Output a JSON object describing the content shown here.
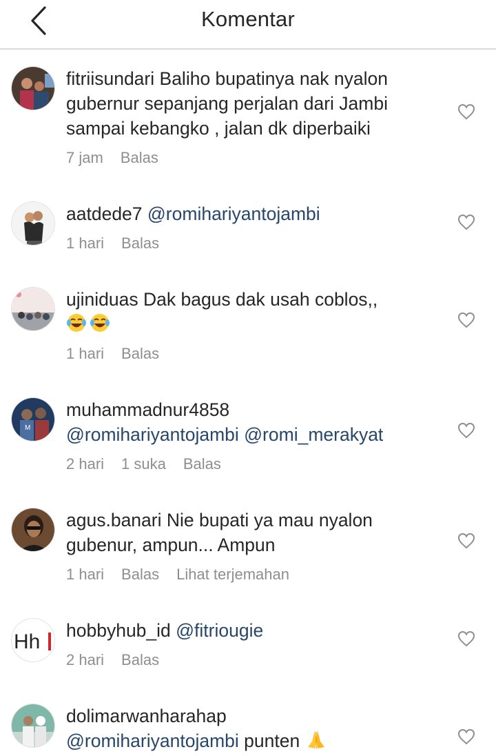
{
  "header": {
    "title": "Komentar",
    "back_icon": "chevron-left-icon"
  },
  "comments": [
    {
      "username": "fitriisundari",
      "text": "Baliho bupatinya nak nyalon gubernur sepanjang perjalan dari Jambi sampai kebangko , jalan dk diperbaiki",
      "time": "7 jam",
      "reply": "Balas"
    },
    {
      "username": "aatdede7",
      "mention": "@romihariyantojambi",
      "time": "1 hari",
      "reply": "Balas"
    },
    {
      "username": "ujiniduas",
      "text": "Dak bagus dak usah coblos,,",
      "emoji": "face-with-tears-of-joy x2",
      "time": "1 hari",
      "reply": "Balas"
    },
    {
      "username": "muhammadnur4858",
      "mention1": "@romihariyantojambi",
      "mention2": "@romi_merakyat",
      "time": "2 hari",
      "likes": "1 suka",
      "reply": "Balas"
    },
    {
      "username": "agus.banari",
      "text": "Nie bupati ya mau nyalon gubenur, ampun... Ampun",
      "time": "1 hari",
      "reply": "Balas",
      "translate": "Lihat terjemahan"
    },
    {
      "username": "hobbyhub_id",
      "mention": "@fitriougie",
      "time": "2 hari",
      "reply": "Balas",
      "avatar_text": "Hh"
    },
    {
      "username": "dolimarwanharahap",
      "mention": "@romihariyantojambi",
      "text": "punten",
      "emoji": "folded-hands"
    }
  ],
  "colors": {
    "text": "#262626",
    "mention": "#26476b",
    "meta": "#8e8e8e",
    "divider": "#dbdbdb"
  }
}
